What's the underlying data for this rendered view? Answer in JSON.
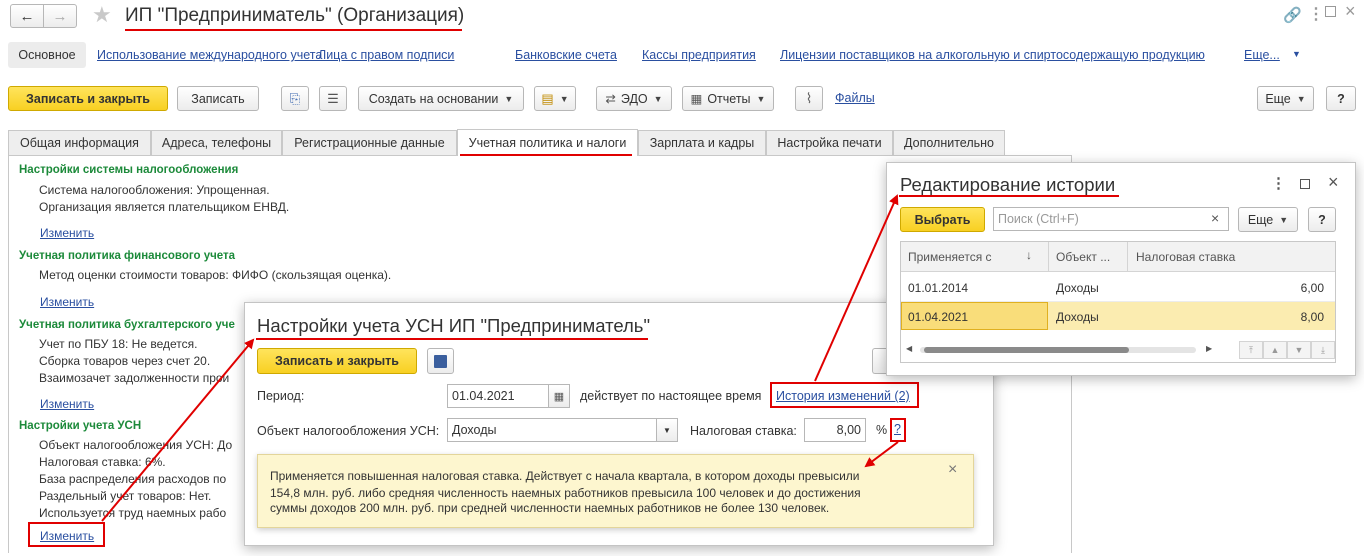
{
  "window": {
    "title": "ИП \"Предприниматель\" (Организация)"
  },
  "nav_links": {
    "main": "Основное",
    "items": [
      "Использование международного учета",
      "Лица с правом подписи",
      "Банковские счета",
      "Кассы предприятия",
      "Лицензии поставщиков на алкогольную и спиртосодержащую продукцию",
      "Еще..."
    ]
  },
  "toolbar": {
    "save_close": "Записать и закрыть",
    "save": "Записать",
    "create_based": "Создать на основании",
    "edo": "ЭДО",
    "reports": "Отчеты",
    "files": "Файлы",
    "more": "Еще",
    "help": "?"
  },
  "tabs": [
    "Общая информация",
    "Адреса, телефоны",
    "Регистрационные данные",
    "Учетная политика и налоги",
    "Зарплата и кадры",
    "Настройка печати",
    "Дополнительно"
  ],
  "sections": {
    "tax_system": {
      "title": "Настройки системы налогообложения",
      "lines": [
        "Система налогообложения: Упрощенная.",
        "Организация является плательщиком ЕНВД."
      ],
      "link": "Изменить"
    },
    "fin_policy": {
      "title": "Учетная политика финансового учета",
      "lines": [
        "Метод оценки стоимости товаров: ФИФО (скользящая оценка)."
      ],
      "link": "Изменить"
    },
    "acc_policy": {
      "title": "Учетная политика бухгалтерского уче",
      "lines": [
        "Учет по ПБУ 18: Не ведется.",
        "Сборка товаров через счет 20.",
        "Взаимозачет задолженности прои"
      ],
      "link": "Изменить"
    },
    "usn": {
      "title": "Настройки учета УСН",
      "lines": [
        "Объект налогообложения УСН: До",
        "Налоговая ставка: 6%.",
        "База распределения расходов по",
        "Раздельный учет товаров: Нет.",
        "Используется труд наемных рабо"
      ],
      "link": "Изменить"
    }
  },
  "usn_dialog": {
    "title": "Настройки учета УСН ИП \"Предприниматель\"",
    "save_close": "Записать и закрыть",
    "period_label": "Период:",
    "period_value": "01.04.2021",
    "valid_text": "действует по настоящее время",
    "history_link": "История изменений (2)",
    "object_label": "Объект налогообложения УСН:",
    "object_value": "Доходы",
    "rate_label": "Налоговая ставка:",
    "rate_value": "8,00",
    "percent": "%",
    "help": "?",
    "tooltip": [
      "Применяется повышенная налоговая ставка. Действует с начала квартала, в котором доходы превысили",
      "154,8 млн. руб. либо средняя численность наемных работников превысила 100 человек и до достижения",
      "суммы доходов 200 млн. руб. при средней численности наемных работников не более 130 человек."
    ],
    "tooltip_close": "×"
  },
  "history_dialog": {
    "title": "Редактирование истории",
    "select": "Выбрать",
    "search_placeholder": "Поиск (Ctrl+F)",
    "more": "Еще",
    "help": "?",
    "columns": [
      "Применяется с",
      "Объект ...",
      "Налоговая ставка"
    ],
    "rows": [
      {
        "date": "01.01.2014",
        "object": "Доходы",
        "rate": "6,00"
      },
      {
        "date": "01.04.2021",
        "object": "Доходы",
        "rate": "8,00"
      }
    ]
  },
  "colors": {
    "accent_yellow": "#f8d022",
    "section_green": "#1c8a3a",
    "link_blue": "#2a4fa0",
    "highlight_red": "#e00000",
    "selected_row": "#fbecb0"
  }
}
